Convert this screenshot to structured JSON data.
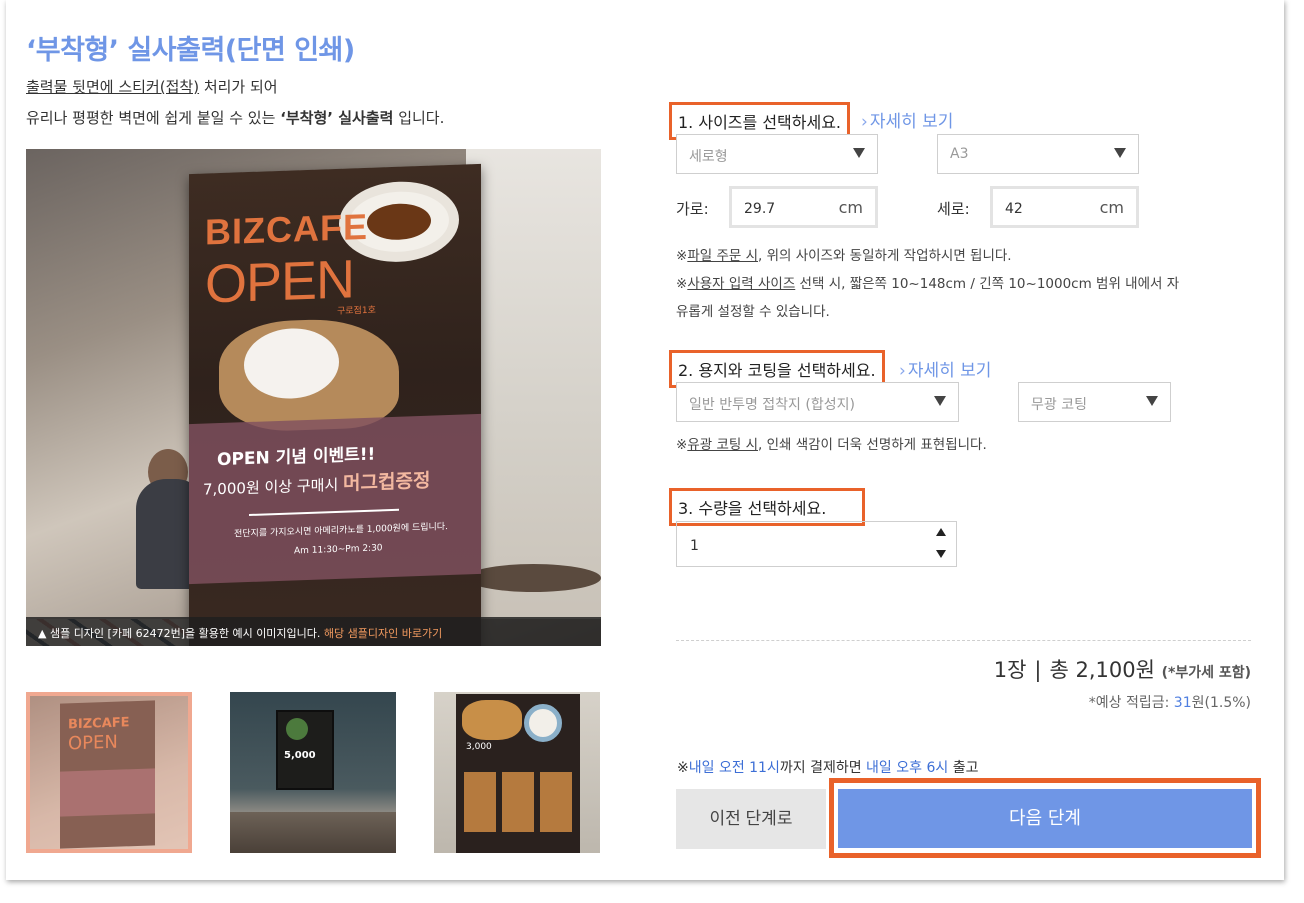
{
  "header": {
    "title": "‘부착형’ 실사출력(단면 인쇄)",
    "desc_line1_underlined": "출력물 뒷면에 스티커(접착)",
    "desc_line1_rest": " 처리가 되어",
    "desc_line2_pre": "유리나 평평한 벽면에 쉽게 붙일 수 있는 ",
    "desc_line2_bold": "‘부착형’ 실사출력",
    "desc_line2_post": " 입니다."
  },
  "preview": {
    "poster": {
      "brand": "BIZCAFE",
      "open": "OPEN",
      "branch": "구로점1호",
      "event_title": "OPEN 기념 이벤트!!",
      "event_line_pre": "7,000원 이상 구매시 ",
      "event_line_highlight": "머그컵증정",
      "event_detail": "전단지를 가지오시면 아메리카노를 1,000원에 드립니다.",
      "event_time": "Am 11:30~Pm 2:30"
    },
    "caption_text": "▲ 샘플 디자인 [카페 62472번]을 활용한 예시 이미지입니다. ",
    "caption_link": "해당 샘플디자인 바로가기",
    "thumbnails": [
      {
        "brand": "BIZCAFE",
        "open": "OPEN",
        "selected": true
      },
      {
        "price": "5,000",
        "selected": false
      },
      {
        "price": "3,000",
        "selected": false
      }
    ]
  },
  "steps": {
    "size": {
      "label": "1. 사이즈를 선택하세요.",
      "more": "자세히 보기",
      "orientation": "세로형",
      "paper_size": "A3",
      "width_label": "가로:",
      "width_value": "29.7",
      "height_label": "세로:",
      "height_value": "42",
      "unit": "cm",
      "note1_link": "파일 주문 시",
      "note1_text": ", 위의 사이즈와 동일하게 작업하시면 됩니다.",
      "note2_link": "사용자 입력 사이즈",
      "note2_text": " 선택 시, 짧은쪽 10~148cm / 긴쪽 10~1000cm 범위 내에서 자",
      "note2_text2": "유롭게 설정할 수 있습니다."
    },
    "paper": {
      "label": "2. 용지와 코팅을 선택하세요.",
      "more": "자세히 보기",
      "paper_type": "일반 반투명 접착지 (합성지)",
      "coating": "무광 코팅",
      "note_link": "유광 코팅 시",
      "note_text": ", 인쇄 색감이 더욱 선명하게 표현됩니다."
    },
    "quantity": {
      "label": "3. 수량을 선택하세요.",
      "value": "1"
    }
  },
  "summary": {
    "sheets": "1장",
    "separator": "|",
    "total": "총 2,100원",
    "vat": "(*부가세 포함)",
    "points_pre": "*예상 적립금: ",
    "points_value": "31",
    "points_post": "원(1.5%)"
  },
  "delivery": {
    "prefix": "※",
    "time1": "내일 오전 11시",
    "mid": "까지 결제하면 ",
    "time2": "내일 오후 6시",
    "suffix": " 출고"
  },
  "buttons": {
    "prev": "이전 단계로",
    "next": "다음 단계"
  },
  "colors": {
    "accent": "#6f96e6",
    "highlight_border": "#e9622a",
    "caption_link": "#f29a5f"
  }
}
